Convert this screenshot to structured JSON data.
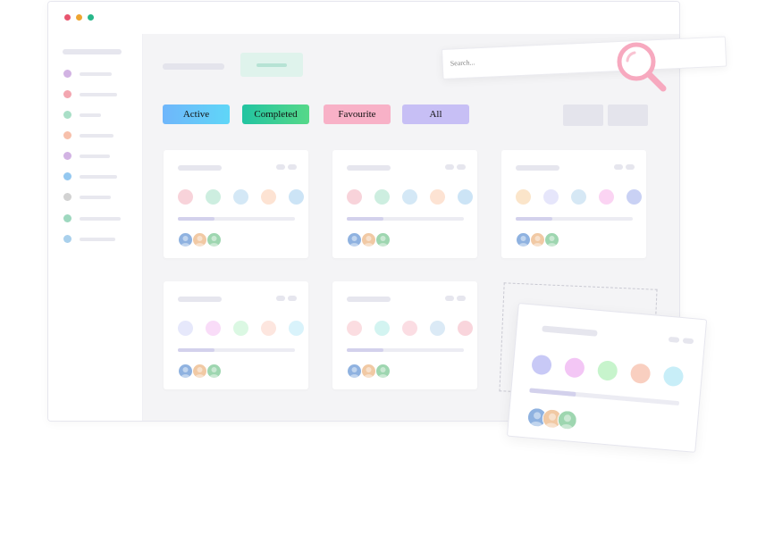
{
  "window": {
    "traffic_lights": [
      "#e8556f",
      "#eea531",
      "#28b78a"
    ]
  },
  "sidebar": {
    "items": [
      {
        "color": "#d2b3e3"
      },
      {
        "color": "#f3a6b0"
      },
      {
        "color": "#a9dfc7"
      },
      {
        "color": "#f7c0ab"
      },
      {
        "color": "#d2b3e3"
      },
      {
        "color": "#94c8f0"
      },
      {
        "color": "#d2d2d2"
      },
      {
        "color": "#9ed8bf"
      },
      {
        "color": "#a9d0ec"
      }
    ]
  },
  "filters": {
    "active": "Active",
    "completed": "Completed",
    "favourite": "Favourite",
    "all": "All"
  },
  "search": {
    "placeholder": "Search..."
  },
  "cards": [
    {
      "circles": [
        "#f8d3da",
        "#cdeee0",
        "#d4e8f6",
        "#fde3d3",
        "#cce4f6"
      ],
      "progress": 0.31
    },
    {
      "circles": [
        "#f8d3da",
        "#cdeee0",
        "#d4e8f6",
        "#fde3d3",
        "#cce4f6"
      ],
      "progress": 0.31
    },
    {
      "circles": [
        "#fbe5ca",
        "#e6e6fb",
        "#d6e8f5",
        "#fbd4f3",
        "#c9d1f4"
      ],
      "progress": 0.31
    },
    {
      "circles": [
        "#e6e8fb",
        "#f9dcf8",
        "#dbf8e3",
        "#fde6df",
        "#d9f3fb"
      ],
      "progress": 0.31
    },
    {
      "circles": [
        "#fbdde1",
        "#d3f4f1",
        "#fbdde3",
        "#dbeaf6",
        "#f9d5dc"
      ],
      "progress": 0.31
    }
  ],
  "drag_card": {
    "circles": [
      "#c8c9f6",
      "#f3c6f5",
      "#c7f4cc",
      "#f9cfc0",
      "#c8eef8"
    ],
    "progress": 0.31
  },
  "avatars": [
    "#8fb2e0",
    "#f1c9a4",
    "#9ed6b0"
  ]
}
